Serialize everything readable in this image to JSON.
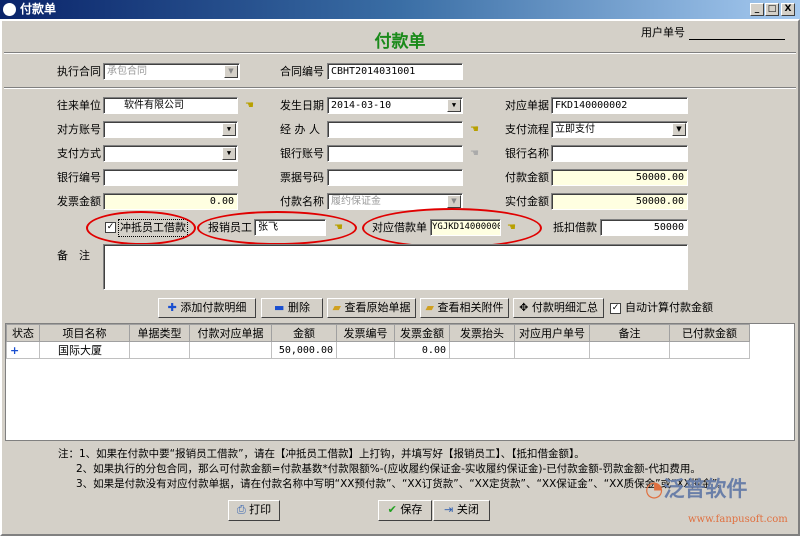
{
  "window": {
    "title": "付款单",
    "min": "_",
    "max": "□",
    "close": "X"
  },
  "header": {
    "title": "付款单",
    "user_no_label": "用户单号",
    "user_no_value": ""
  },
  "contract": {
    "exec_label": "执行合同",
    "exec_value": "承包合同",
    "no_label": "合同编号",
    "no_value": "CBHT2014031001"
  },
  "fields": {
    "partner_label": "往来单位",
    "partner_value": "软件有限公司",
    "date_label": "发生日期",
    "date_value": "2014-03-10",
    "doc_label": "对应单据",
    "doc_value": "FKD140000002",
    "account_label": "对方账号",
    "account_value": "",
    "handler_label": "经 办 人",
    "handler_value": "",
    "flow_label": "支付流程",
    "flow_value": "立即支付",
    "paymethod_label": "支付方式",
    "paymethod_value": "",
    "bankacc_label": "银行账号",
    "bankacc_value": "",
    "bankname_label": "银行名称",
    "bankname_value": "",
    "bankno_label": "银行编号",
    "bankno_value": "",
    "billno_label": "票据号码",
    "billno_value": "",
    "payamt_label": "付款金额",
    "payamt_value": "50000.00",
    "invamt_label": "发票金额",
    "invamt_value": "0.00",
    "payname_label": "付款名称",
    "payname_value": "履约保证金",
    "actual_label": "实付金额",
    "actual_value": "50000.00",
    "offset_label": "冲抵员工借款",
    "offset_checked": true,
    "employee_label": "报销员工",
    "employee_value": "张飞",
    "loan_label": "对应借款单",
    "loan_value": "YGJKD14000000",
    "deduct_label": "抵扣借款",
    "deduct_value": "50000",
    "remark_label": "备　注",
    "remark_value": ""
  },
  "toolbar": {
    "add": "添加付款明细",
    "del": "删除",
    "view_orig": "查看原始单据",
    "view_attach": "查看相关附件",
    "summary": "付款明细汇总",
    "auto_calc": "自动计算付款金额",
    "auto_calc_checked": true
  },
  "table": {
    "headers": [
      "状态",
      "项目名称",
      "单据类型",
      "付款对应单据",
      "金额",
      "发票编号",
      "发票金额",
      "发票抬头",
      "对应用户单号",
      "备注",
      "已付款金额"
    ],
    "rows": [
      [
        "+",
        "国际大厦",
        "",
        "",
        "50,000.00",
        "",
        "0.00",
        "",
        "",
        "",
        ""
      ]
    ]
  },
  "notes": [
    "注：1、如果在付款中要“报销员工借款”，请在【冲抵员工借款】上打钩，并填写好【报销员工】、【抵扣借金额】。",
    "2、如果执行的分包合同，那么可付款金额=付款基数*付款限额%-(应收履约保证金-实收履约保证金)-已付款金额-罚款金额-代扣费用。",
    "3、如果是付款没有对应付款单据，请在付款名称中写明“XX预付款”、“XX订货款”、“XX定货款”、“XX保证金”、“XX质保金”或“XX押金”。"
  ],
  "buttons": {
    "print": "打印",
    "save": "保存",
    "close": "关闭"
  },
  "brand": {
    "name": "泛普软件",
    "url": "www.fanpusoft.com"
  }
}
